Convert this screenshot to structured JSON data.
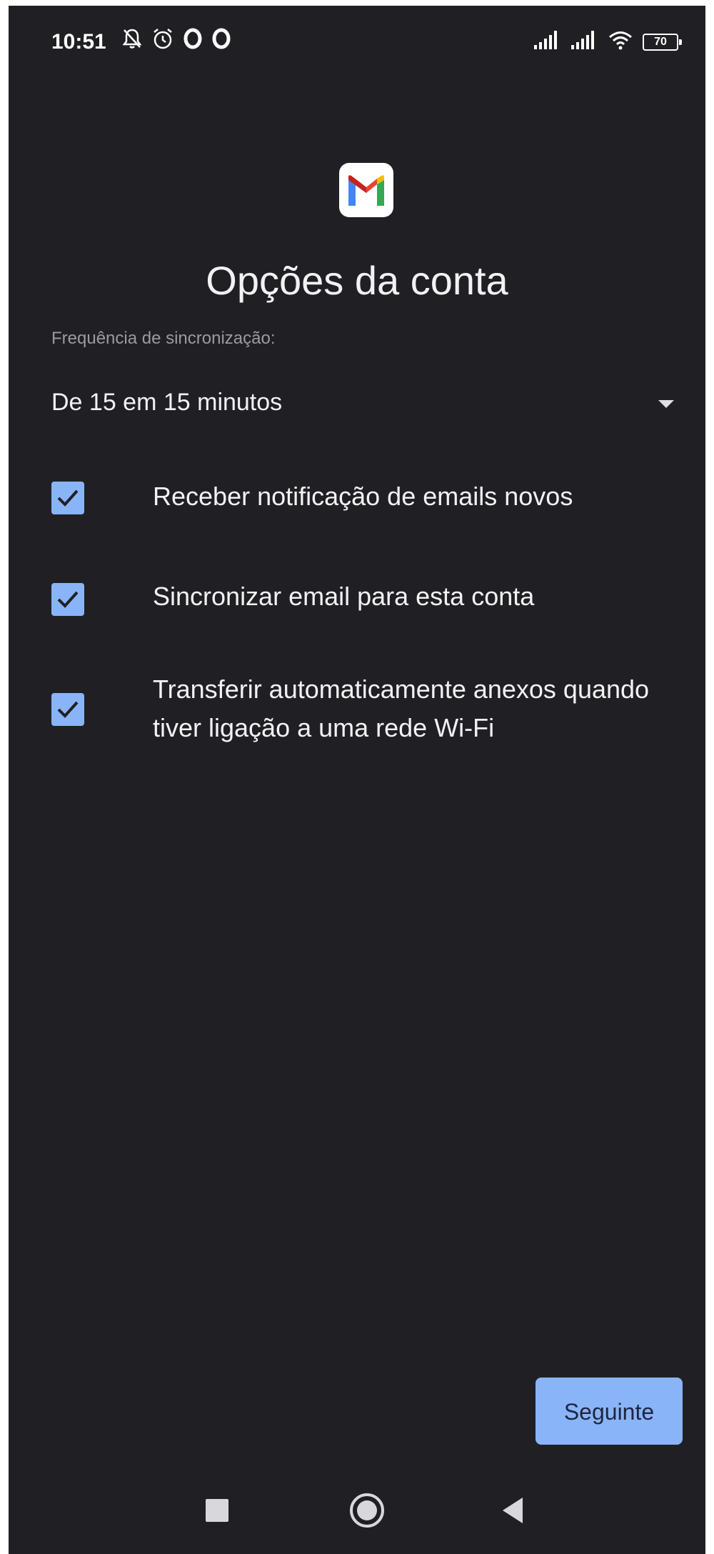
{
  "status_bar": {
    "time": "10:51",
    "battery": "70",
    "icons": [
      "notifications-off-icon",
      "alarm-icon",
      "o-app-icon",
      "o-app-icon",
      "signal-icon",
      "signal-icon",
      "wifi-icon",
      "battery-icon"
    ]
  },
  "header": {
    "logo": "gmail-logo",
    "title": "Opções da conta"
  },
  "sync": {
    "label": "Frequência de sincronização:",
    "value": "De 15 em 15 minutos"
  },
  "options": [
    {
      "label": "Receber notificação de emails novos",
      "checked": true
    },
    {
      "label": "Sincronizar email para esta conta",
      "checked": true
    },
    {
      "label": "Transferir automaticamente anexos quando tiver ligação a uma rede Wi-Fi",
      "checked": true
    }
  ],
  "actions": {
    "next_label": "Seguinte"
  },
  "colors": {
    "background": "#202024",
    "accent": "#8ab4f8",
    "text": "#f2f2f4",
    "secondary_text": "#9a9aa0"
  }
}
